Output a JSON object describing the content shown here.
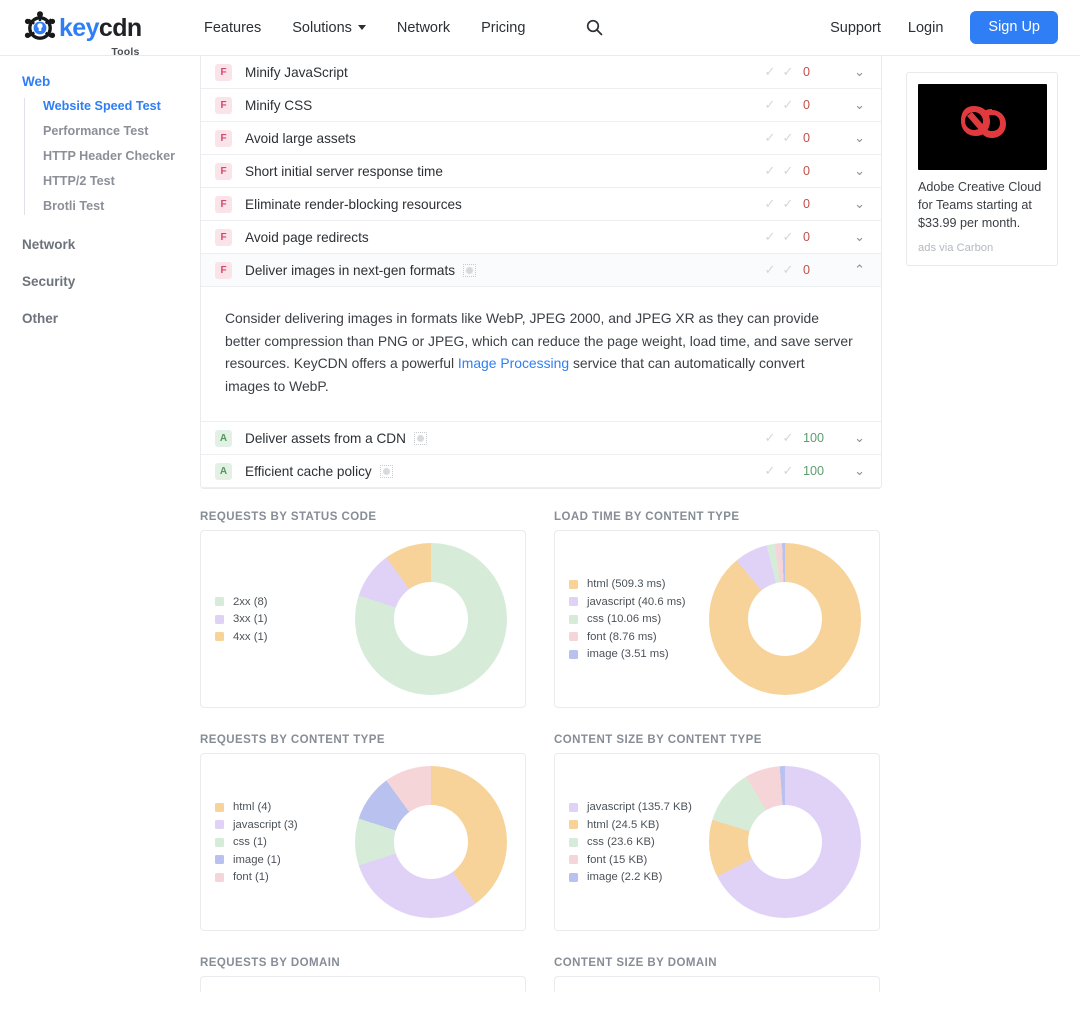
{
  "header": {
    "logo": {
      "key": "key",
      "cdn": "cdn",
      "sub": "Tools"
    },
    "nav": [
      {
        "label": "Features",
        "has_caret": false
      },
      {
        "label": "Solutions",
        "has_caret": true
      },
      {
        "label": "Network",
        "has_caret": false
      },
      {
        "label": "Pricing",
        "has_caret": false
      }
    ],
    "search_icon": "search-icon",
    "support_label": "Support",
    "login_label": "Login",
    "signup_label": "Sign Up",
    "accent_color": "#2f7ef5"
  },
  "sidebar": {
    "groups": [
      {
        "label": "Web",
        "active": true,
        "items": [
          {
            "label": "Website Speed Test",
            "active": true
          },
          {
            "label": "Performance Test",
            "active": false
          },
          {
            "label": "HTTP Header Checker",
            "active": false
          },
          {
            "label": "HTTP/2 Test",
            "active": false
          },
          {
            "label": "Brotli Test",
            "active": false
          }
        ]
      },
      {
        "label": "Network",
        "active": false,
        "items": []
      },
      {
        "label": "Security",
        "active": false,
        "items": []
      },
      {
        "label": "Other",
        "active": false,
        "items": []
      }
    ]
  },
  "audits": [
    {
      "grade": "F",
      "title": "Minify JavaScript",
      "score": "0",
      "score_state": "bad",
      "expanded": false,
      "has_image_icon": false
    },
    {
      "grade": "F",
      "title": "Minify CSS",
      "score": "0",
      "score_state": "bad",
      "expanded": false,
      "has_image_icon": false
    },
    {
      "grade": "F",
      "title": "Avoid large assets",
      "score": "0",
      "score_state": "bad",
      "expanded": false,
      "has_image_icon": false
    },
    {
      "grade": "F",
      "title": "Short initial server response time",
      "score": "0",
      "score_state": "bad",
      "expanded": false,
      "has_image_icon": false
    },
    {
      "grade": "F",
      "title": "Eliminate render-blocking resources",
      "score": "0",
      "score_state": "bad",
      "expanded": false,
      "has_image_icon": false
    },
    {
      "grade": "F",
      "title": "Avoid page redirects",
      "score": "0",
      "score_state": "bad",
      "expanded": false,
      "has_image_icon": false
    },
    {
      "grade": "F",
      "title": "Deliver images in next-gen formats",
      "score": "0",
      "score_state": "bad",
      "expanded": true,
      "has_image_icon": true
    },
    {
      "grade": "A",
      "title": "Deliver assets from a CDN",
      "score": "100",
      "score_state": "good",
      "expanded": false,
      "has_image_icon": true
    },
    {
      "grade": "A",
      "title": "Efficient cache policy",
      "score": "100",
      "score_state": "good",
      "expanded": false,
      "has_image_icon": true
    }
  ],
  "audit_detail": {
    "part1": "Consider delivering images in formats like WebP, JPEG 2000, and JPEG XR as they can provide better compression than PNG or JPEG, which can reduce the page weight, load time, and save server resources. KeyCDN offers a powerful ",
    "link": "Image Processing",
    "part2": " service that can automatically convert images to WebP."
  },
  "ad": {
    "text": "Adobe Creative Cloud for Teams starting at $33.99 per month.",
    "via": "ads via Carbon",
    "image_name": "adobe-creative-cloud-logo"
  },
  "chart_data": [
    {
      "type": "pie",
      "title": "REQUESTS BY STATUS CODE",
      "categories": [
        "2xx",
        "3xx",
        "4xx"
      ],
      "labels": [
        "2xx (8)",
        "3xx (1)",
        "4xx (1)"
      ],
      "values": [
        8,
        1,
        1
      ],
      "colors": [
        "#d6ecd9",
        "#e0d2f7",
        "#f7d39a"
      ],
      "legend": "left",
      "donut": true
    },
    {
      "type": "pie",
      "title": "LOAD TIME BY CONTENT TYPE",
      "categories": [
        "html",
        "javascript",
        "css",
        "font",
        "image"
      ],
      "labels": [
        "html (509.3 ms)",
        "javascript (40.6 ms)",
        "css (10.06 ms)",
        "font (8.76 ms)",
        "image (3.51 ms)"
      ],
      "values": [
        509.3,
        40.6,
        10.06,
        8.76,
        3.51
      ],
      "unit": "ms",
      "colors": [
        "#f7d39a",
        "#e0d2f7",
        "#d6ecd9",
        "#f6d5d8",
        "#b9c2ef"
      ],
      "legend": "left",
      "donut": true
    },
    {
      "type": "pie",
      "title": "REQUESTS BY CONTENT TYPE",
      "categories": [
        "html",
        "javascript",
        "css",
        "image",
        "font"
      ],
      "labels": [
        "html (4)",
        "javascript (3)",
        "css (1)",
        "image (1)",
        "font (1)"
      ],
      "values": [
        4,
        3,
        1,
        1,
        1
      ],
      "colors": [
        "#f7d39a",
        "#e0d2f7",
        "#d6ecd9",
        "#b9c2ef",
        "#f6d5d8"
      ],
      "legend": "left",
      "donut": true
    },
    {
      "type": "pie",
      "title": "CONTENT SIZE BY CONTENT TYPE",
      "categories": [
        "javascript",
        "html",
        "css",
        "font",
        "image"
      ],
      "labels": [
        "javascript (135.7 KB)",
        "html (24.5 KB)",
        "css (23.6 KB)",
        "font (15 KB)",
        "image (2.2 KB)"
      ],
      "values": [
        135.7,
        24.5,
        23.6,
        15,
        2.2
      ],
      "unit": "KB",
      "colors": [
        "#e0d2f7",
        "#f7d39a",
        "#d6ecd9",
        "#f6d5d8",
        "#b9c2ef"
      ],
      "legend": "left",
      "donut": true
    }
  ],
  "bottom_titles": {
    "requests_by_domain": "REQUESTS BY DOMAIN",
    "content_size_by_domain": "CONTENT SIZE BY DOMAIN"
  }
}
